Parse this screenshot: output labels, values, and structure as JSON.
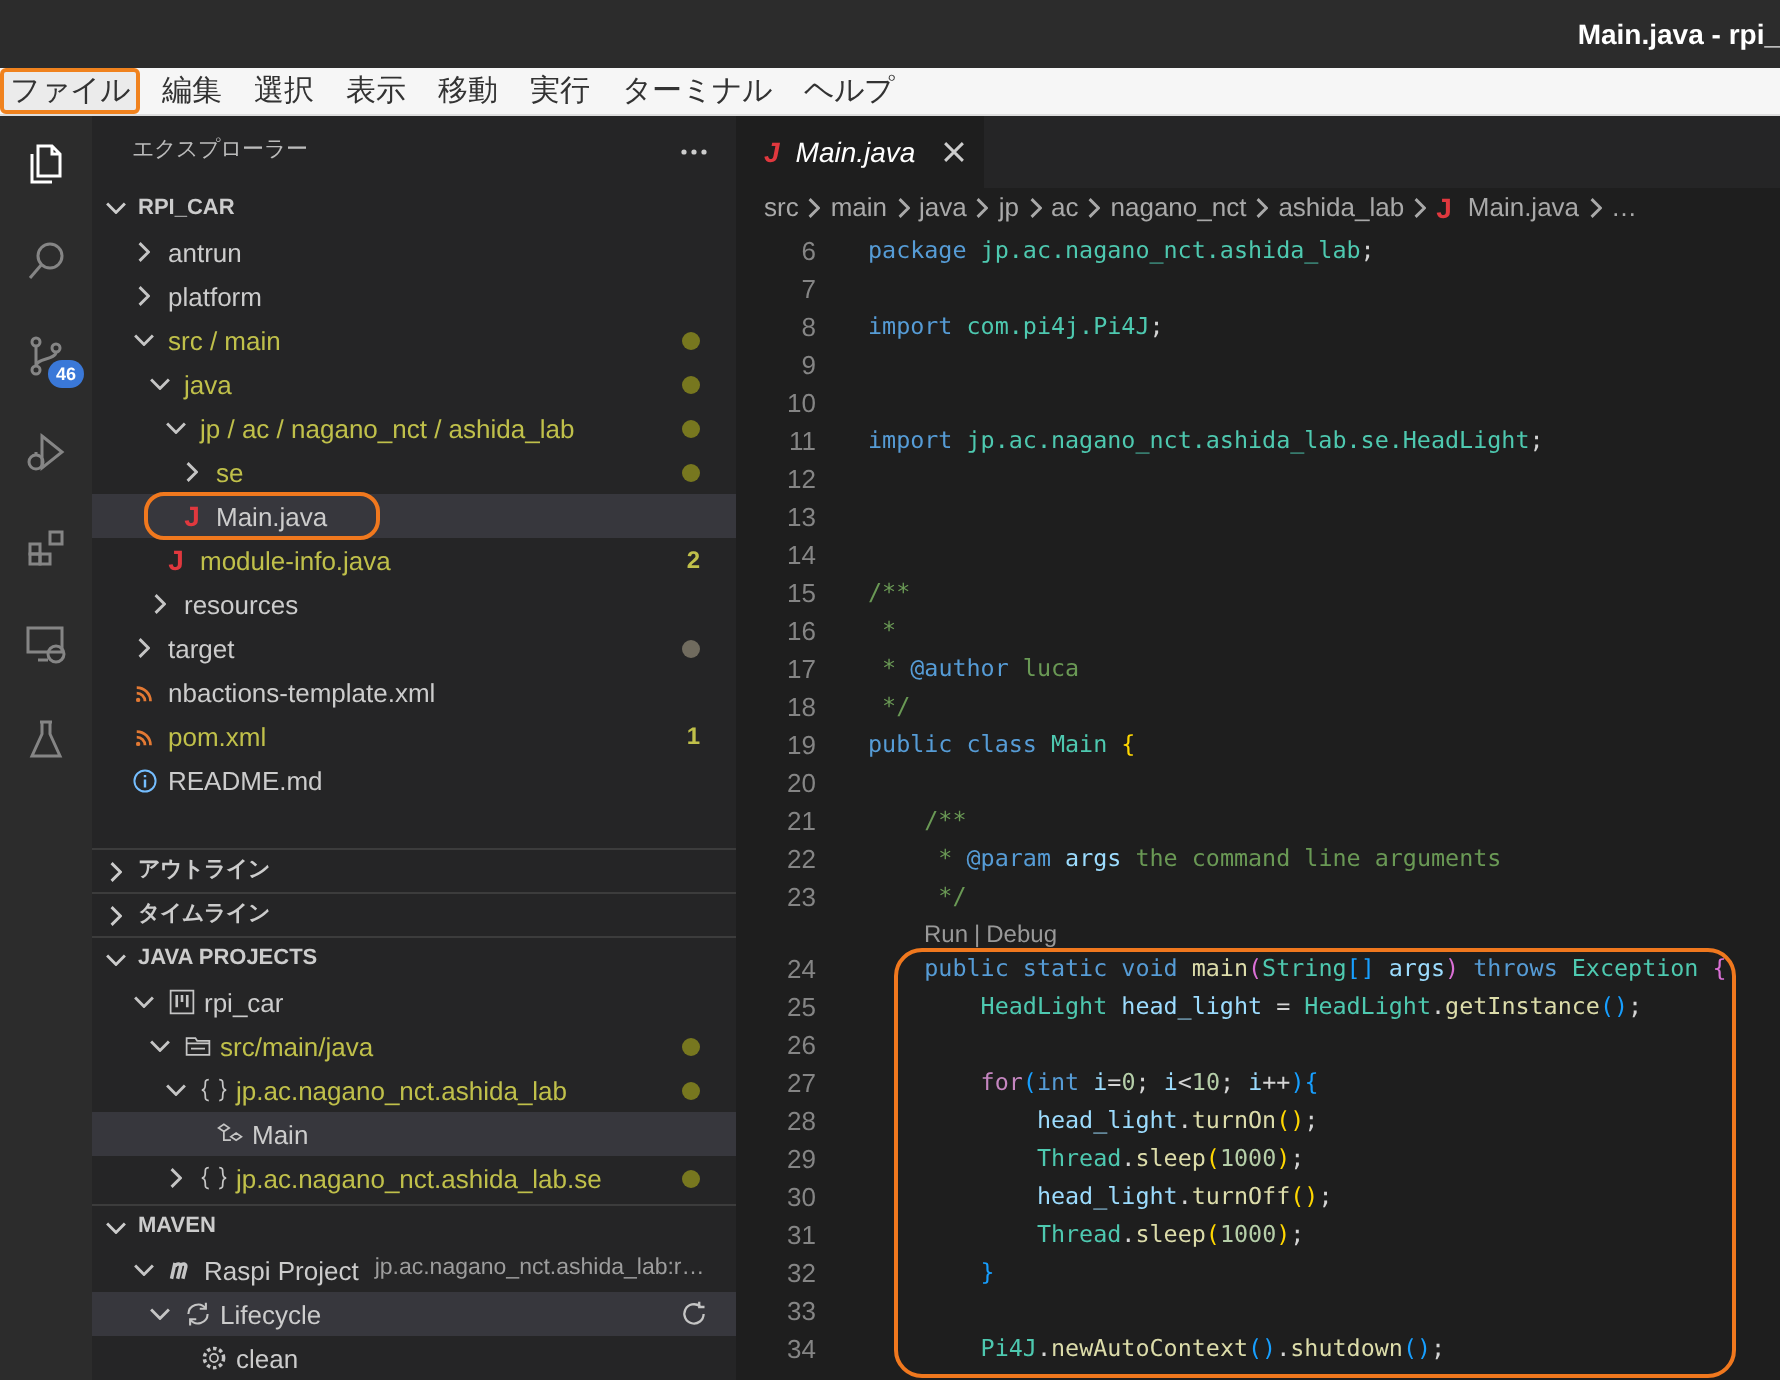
{
  "window": {
    "title": "Main.java - rpi_"
  },
  "menu": [
    {
      "label": "ファイル",
      "selected": true
    },
    {
      "label": "編集",
      "selected": false
    },
    {
      "label": "選択",
      "selected": false
    },
    {
      "label": "表示",
      "selected": false
    },
    {
      "label": "移動",
      "selected": false
    },
    {
      "label": "実行",
      "selected": false
    },
    {
      "label": "ターミナル",
      "selected": false
    },
    {
      "label": "ヘルプ",
      "selected": false
    }
  ],
  "activity_bar": [
    {
      "kind": "explorer",
      "selected": true
    },
    {
      "kind": "search",
      "selected": false
    },
    {
      "kind": "scm",
      "selected": false,
      "badge": "46"
    },
    {
      "kind": "debug",
      "selected": false
    },
    {
      "kind": "extensions",
      "selected": false
    },
    {
      "kind": "remote",
      "selected": false
    },
    {
      "kind": "testing",
      "selected": false
    }
  ],
  "explorer": {
    "title": "エクスプローラー",
    "root": {
      "label": "RPI_CAR",
      "expanded": true
    },
    "items": [
      {
        "label": "antrun",
        "kind": "folder",
        "expanded": false,
        "modified": false,
        "selected": false,
        "boxed": false
      },
      {
        "label": "platform",
        "kind": "folder",
        "expanded": false,
        "modified": false,
        "selected": false,
        "boxed": false
      },
      {
        "label": "src / main",
        "kind": "folder",
        "expanded": true,
        "modified": true,
        "selected": false,
        "boxed": false,
        "color": "#77771f",
        "children": [
          {
            "label": "java",
            "kind": "folder",
            "expanded": true,
            "modified": true,
            "selected": false,
            "boxed": false,
            "color": "#77771f",
            "children": [
              {
                "label": "jp / ac / nagano_nct / ashida_lab",
                "kind": "folder",
                "expanded": true,
                "modified": true,
                "selected": false,
                "boxed": false,
                "color": "#77771f",
                "children": [
                  {
                    "label": "se",
                    "kind": "folder",
                    "expanded": false,
                    "modified": true,
                    "selected": false,
                    "boxed": false,
                    "color": "#77771f"
                  },
                  {
                    "label": "Main.java",
                    "kind": "java",
                    "glyph": "J",
                    "modified": false,
                    "selected": true,
                    "boxed": true
                  }
                ]
              },
              {
                "label": "module-info.java",
                "kind": "java",
                "glyph": "J",
                "modified": true,
                "selected": false,
                "boxed": false,
                "badge": "2"
              }
            ]
          },
          {
            "label": "resources",
            "kind": "folder",
            "expanded": false,
            "modified": false,
            "selected": false,
            "boxed": false
          }
        ]
      },
      {
        "label": "target",
        "kind": "folder",
        "expanded": false,
        "modified": false,
        "selected": false,
        "boxed": false,
        "color": "#706b5e"
      },
      {
        "label": "nbactions-template.xml",
        "kind": "xml",
        "modified": false,
        "selected": false,
        "boxed": false
      },
      {
        "label": "pom.xml",
        "kind": "xml",
        "modified": true,
        "selected": false,
        "boxed": false,
        "badge": "1"
      },
      {
        "label": "README.md",
        "kind": "info",
        "modified": false,
        "selected": false,
        "boxed": false
      }
    ]
  },
  "sections": [
    {
      "title": "アウトライン",
      "expanded": false
    },
    {
      "title": "タイムライン",
      "expanded": false
    }
  ],
  "java_projects": {
    "title": "JAVA PROJECTS",
    "expanded": true,
    "items": [
      {
        "label": "rpi_car",
        "kind": "project",
        "expanded": true,
        "modified": false,
        "selected": false,
        "children": [
          {
            "label": "src/main/java",
            "kind": "source",
            "expanded": true,
            "modified": true,
            "selected": false,
            "color": "#77771f",
            "children": [
              {
                "label": "jp.ac.nagano_nct.ashida_lab",
                "kind": "package",
                "expanded": true,
                "modified": true,
                "selected": false,
                "color": "#77771f",
                "children": [
                  {
                    "label": "Main",
                    "kind": "class",
                    "modified": false,
                    "selected": true
                  }
                ]
              },
              {
                "label": "jp.ac.nagano_nct.ashida_lab.se",
                "kind": "package",
                "expanded": false,
                "modified": true,
                "selected": false,
                "color": "#77771f"
              }
            ]
          }
        ]
      }
    ]
  },
  "maven": {
    "title": "MAVEN",
    "expanded": true,
    "items": [
      {
        "label": "Raspi Project",
        "description": "jp.ac.nagano_nct.ashida_lab:r…",
        "kind": "maven",
        "expanded": true,
        "modified": false,
        "selected": false,
        "children": [
          {
            "label": "Lifecycle",
            "kind": "lifecycle",
            "expanded": true,
            "modified": false,
            "selected": true,
            "children": [
              {
                "label": "clean",
                "kind": "goal",
                "modified": false,
                "selected": false
              }
            ]
          }
        ]
      }
    ]
  },
  "editor": {
    "tabs": [
      {
        "label": "Main.java",
        "glyph": "J",
        "selected": true,
        "preview": true
      }
    ],
    "breadcrumbs": [
      {
        "label": "src"
      },
      {
        "label": "main"
      },
      {
        "label": "java"
      },
      {
        "label": "jp"
      },
      {
        "label": "ac"
      },
      {
        "label": "nagano_nct"
      },
      {
        "label": "ashida_lab"
      },
      {
        "label": "Main.java",
        "glyph": "J"
      },
      {
        "label": "…"
      }
    ],
    "lines": [
      {
        "kind": "code",
        "number": "6",
        "tokens": [
          {
            "text": "package ",
            "kind": "kw"
          },
          {
            "text": "jp.ac.nagano_nct.ashida_lab",
            "kind": "type"
          },
          {
            "text": ";",
            "kind": "p"
          }
        ]
      },
      {
        "kind": "code",
        "number": "7"
      },
      {
        "kind": "code",
        "number": "8",
        "tokens": [
          {
            "text": "import ",
            "kind": "kw"
          },
          {
            "text": "com.pi4j.Pi4J",
            "kind": "type"
          },
          {
            "text": ";",
            "kind": "p"
          }
        ]
      },
      {
        "kind": "code",
        "number": "9"
      },
      {
        "kind": "code",
        "number": "10"
      },
      {
        "kind": "code",
        "number": "11",
        "tokens": [
          {
            "text": "import ",
            "kind": "kw"
          },
          {
            "text": "jp.ac.nagano_nct.ashida_lab.se.HeadLight",
            "kind": "type"
          },
          {
            "text": ";",
            "kind": "p"
          }
        ]
      },
      {
        "kind": "code",
        "number": "12"
      },
      {
        "kind": "code",
        "number": "13"
      },
      {
        "kind": "code",
        "number": "14"
      },
      {
        "kind": "code",
        "number": "15",
        "tokens": [
          {
            "text": "/**",
            "kind": "cmt"
          }
        ]
      },
      {
        "kind": "code",
        "number": "16",
        "tokens": [
          {
            "text": " *",
            "kind": "cmt"
          }
        ]
      },
      {
        "kind": "code",
        "number": "17",
        "tokens": [
          {
            "text": " * ",
            "kind": "cmt"
          },
          {
            "text": "@author",
            "kind": "tag"
          },
          {
            "text": " luca",
            "kind": "cmt"
          }
        ]
      },
      {
        "kind": "code",
        "number": "18",
        "tokens": [
          {
            "text": " */",
            "kind": "cmt"
          }
        ]
      },
      {
        "kind": "code",
        "number": "19",
        "tokens": [
          {
            "text": "public class ",
            "kind": "kw"
          },
          {
            "text": "Main ",
            "kind": "type"
          },
          {
            "text": "{",
            "kind": "b1"
          }
        ]
      },
      {
        "kind": "code",
        "number": "20"
      },
      {
        "kind": "code",
        "number": "21",
        "tokens": [
          {
            "text": "    /**",
            "kind": "cmt"
          }
        ]
      },
      {
        "kind": "code",
        "number": "22",
        "tokens": [
          {
            "text": "     * ",
            "kind": "cmt"
          },
          {
            "text": "@param",
            "kind": "tag"
          },
          {
            "text": " args",
            "kind": "var"
          },
          {
            "text": " the command line arguments",
            "kind": "cmt"
          }
        ]
      },
      {
        "kind": "code",
        "number": "23",
        "tokens": [
          {
            "text": "     */",
            "kind": "cmt"
          }
        ]
      },
      {
        "kind": "codelens",
        "actions": [
          "Run",
          "Debug"
        ],
        "separator": "|"
      },
      {
        "kind": "highlight",
        "lines": [
          {
            "kind": "code",
            "number": "24",
            "tokens": [
              {
                "text": "    public static void ",
                "kind": "kw"
              },
              {
                "text": "main",
                "kind": "fn"
              },
              {
                "text": "(",
                "kind": "b2"
              },
              {
                "text": "String",
                "kind": "type"
              },
              {
                "text": "[]",
                "kind": "b3"
              },
              {
                "text": " args",
                "kind": "var"
              },
              {
                "text": ")",
                "kind": "b2"
              },
              {
                "text": " throws ",
                "kind": "kw"
              },
              {
                "text": "Exception ",
                "kind": "type"
              },
              {
                "text": "{",
                "kind": "b2"
              }
            ]
          },
          {
            "kind": "code",
            "number": "25",
            "tokens": [
              {
                "text": "        HeadLight",
                "kind": "type"
              },
              {
                "text": " head_light",
                "kind": "var"
              },
              {
                "text": " = ",
                "kind": "p"
              },
              {
                "text": "HeadLight",
                "kind": "type"
              },
              {
                "text": ".",
                "kind": "p"
              },
              {
                "text": "getInstance",
                "kind": "fn"
              },
              {
                "text": "()",
                "kind": "b3"
              },
              {
                "text": ";",
                "kind": "p"
              }
            ]
          },
          {
            "kind": "code",
            "number": "26"
          },
          {
            "kind": "code",
            "number": "27",
            "tokens": [
              {
                "text": "        for",
                "kind": "ctrl"
              },
              {
                "text": "(",
                "kind": "b3"
              },
              {
                "text": "int",
                "kind": "kw"
              },
              {
                "text": " i",
                "kind": "var"
              },
              {
                "text": "=",
                "kind": "p"
              },
              {
                "text": "0",
                "kind": "num"
              },
              {
                "text": "; ",
                "kind": "p"
              },
              {
                "text": "i",
                "kind": "var"
              },
              {
                "text": "<",
                "kind": "p"
              },
              {
                "text": "10",
                "kind": "num"
              },
              {
                "text": "; ",
                "kind": "p"
              },
              {
                "text": "i",
                "kind": "var"
              },
              {
                "text": "++",
                "kind": "p"
              },
              {
                "text": ")",
                "kind": "b3"
              },
              {
                "text": "{",
                "kind": "b3"
              }
            ]
          },
          {
            "kind": "code",
            "number": "28",
            "tokens": [
              {
                "text": "            head_light",
                "kind": "var"
              },
              {
                "text": ".",
                "kind": "p"
              },
              {
                "text": "turnOn",
                "kind": "fn"
              },
              {
                "text": "()",
                "kind": "b1"
              },
              {
                "text": ";",
                "kind": "p"
              }
            ]
          },
          {
            "kind": "code",
            "number": "29",
            "tokens": [
              {
                "text": "            Thread",
                "kind": "type"
              },
              {
                "text": ".",
                "kind": "p"
              },
              {
                "text": "sleep",
                "kind": "fn"
              },
              {
                "text": "(",
                "kind": "b1"
              },
              {
                "text": "1000",
                "kind": "num"
              },
              {
                "text": ")",
                "kind": "b1"
              },
              {
                "text": ";",
                "kind": "p"
              }
            ]
          },
          {
            "kind": "code",
            "number": "30",
            "tokens": [
              {
                "text": "            head_light",
                "kind": "var"
              },
              {
                "text": ".",
                "kind": "p"
              },
              {
                "text": "turnOff",
                "kind": "fn"
              },
              {
                "text": "()",
                "kind": "b1"
              },
              {
                "text": ";",
                "kind": "p"
              }
            ]
          },
          {
            "kind": "code",
            "number": "31",
            "tokens": [
              {
                "text": "            Thread",
                "kind": "type"
              },
              {
                "text": ".",
                "kind": "p"
              },
              {
                "text": "sleep",
                "kind": "fn"
              },
              {
                "text": "(",
                "kind": "b1"
              },
              {
                "text": "1000",
                "kind": "num"
              },
              {
                "text": ")",
                "kind": "b1"
              },
              {
                "text": ";",
                "kind": "p"
              }
            ]
          },
          {
            "kind": "code",
            "number": "32",
            "tokens": [
              {
                "text": "        }",
                "kind": "b3"
              }
            ]
          },
          {
            "kind": "code",
            "number": "33"
          },
          {
            "kind": "code",
            "number": "34",
            "tokens": [
              {
                "text": "        Pi4J",
                "kind": "type"
              },
              {
                "text": ".",
                "kind": "p"
              },
              {
                "text": "newAutoContext",
                "kind": "fn"
              },
              {
                "text": "()",
                "kind": "b3"
              },
              {
                "text": ".",
                "kind": "p"
              },
              {
                "text": "shutdown",
                "kind": "fn"
              },
              {
                "text": "()",
                "kind": "b3"
              },
              {
                "text": ";",
                "kind": "p"
              }
            ]
          }
        ]
      }
    ]
  }
}
